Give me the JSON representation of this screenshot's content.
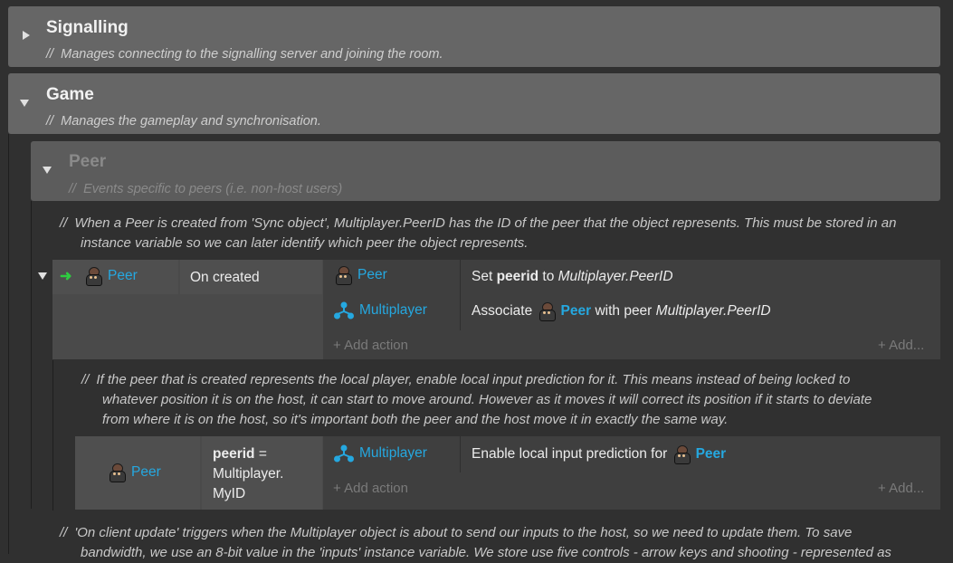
{
  "groups": {
    "signalling": {
      "title": "Signalling",
      "desc": "Manages connecting to the signalling server and joining the room."
    },
    "game": {
      "title": "Game",
      "desc": "Manages the gameplay and synchronisation."
    },
    "peer": {
      "title": "Peer",
      "desc": "Events specific to peers (i.e. non-host users)"
    }
  },
  "comment_prefix": "//",
  "comments": {
    "c1_line1": "When a Peer is created from 'Sync object', Multiplayer.PeerID has the ID of the peer that the object represents. This must be stored in an",
    "c1_line2": "instance variable so we can later identify which peer the object represents.",
    "c2_line1": "If the peer that is created represents the local player, enable local input prediction for it. This means instead of being locked to",
    "c2_line2": "whatever position it is on the host, it can start to move around. However as it moves it will correct its position if it starts to deviate",
    "c2_line3": "from where it is on the host, so it's important both the peer and the host move it in exactly the same way.",
    "c3_line1": "'On client update' triggers when the Multiplayer object is about to send our inputs to the host, so we need to update them. To save",
    "c3_line2": "bandwidth, we use an 8-bit value in the 'inputs' instance variable. We store use five controls - arrow keys and shooting - represented as"
  },
  "event1": {
    "condition_object": "Peer",
    "condition_text": "On created",
    "actions": [
      {
        "object": "Peer",
        "text_pre": "Set ",
        "text_bold": "peerid",
        "text_mid": " to ",
        "text_ital": "Multiplayer.PeerID"
      },
      {
        "object": "Multiplayer",
        "text_pre": "Associate ",
        "text_obj": "Peer",
        "text_mid": " with peer ",
        "text_ital": "Multiplayer.PeerID"
      }
    ],
    "add_action": "+ Add action",
    "add_more": "+ Add..."
  },
  "event2": {
    "condition_object": "Peer",
    "condition_var": "peerid",
    "condition_eq": " =",
    "condition_line2": "Multiplayer.",
    "condition_line3": "MyID",
    "action_object": "Multiplayer",
    "action_text": "Enable local input prediction for ",
    "action_obj": "Peer",
    "add_action": "+ Add action",
    "add_more": "+ Add..."
  },
  "icons": {
    "collapsed": "triangle-right-icon",
    "expanded": "triangle-down-icon",
    "trigger": "green-arrow-icon",
    "peer": "peer-sprite-icon",
    "multiplayer": "multiplayer-network-icon"
  },
  "colors": {
    "background": "#303030",
    "group": "#666666",
    "object_link": "#25a8e0",
    "trigger_arrow": "#2ecc40"
  }
}
